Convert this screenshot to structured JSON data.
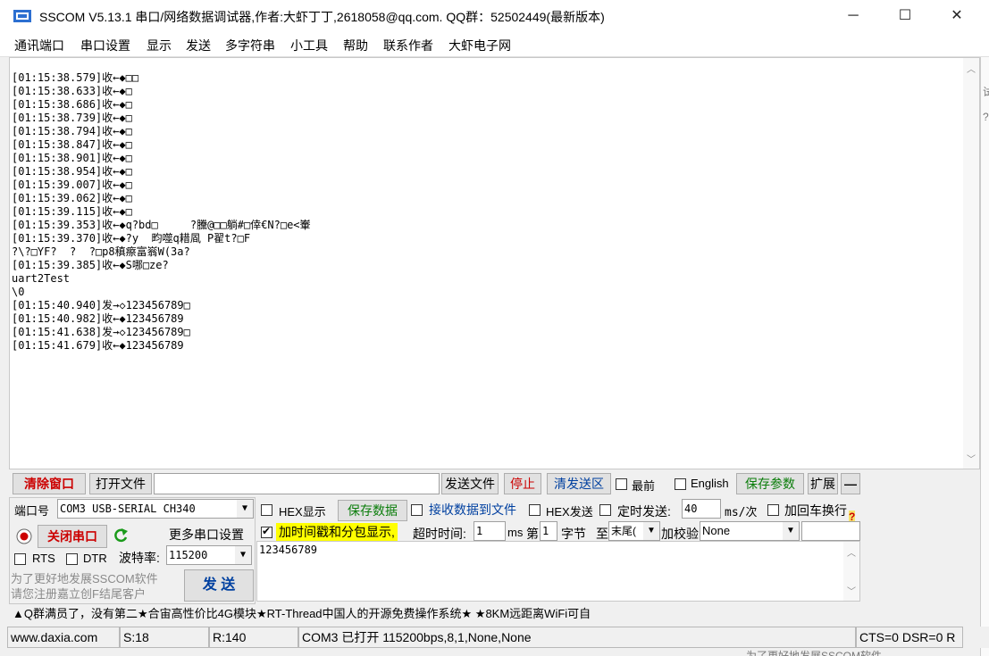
{
  "window": {
    "title": "SSCOM V5.13.1 串口/网络数据调试器,作者:大虾丁丁,2618058@qq.com. QQ群：52502449(最新版本)",
    "minimize": "─",
    "maximize": "☐",
    "close": "✕"
  },
  "menu": [
    "通讯端口",
    "串口设置",
    "显示",
    "发送",
    "多字符串",
    "小工具",
    "帮助",
    "联系作者",
    "大虾电子网"
  ],
  "receive": {
    "lines": [
      "[01:15:38.579]收←◆□□",
      "[01:15:38.633]收←◆□",
      "[01:15:38.686]收←◆□",
      "[01:15:38.739]收←◆□",
      "[01:15:38.794]收←◆□",
      "[01:15:38.847]收←◆□",
      "[01:15:38.901]收←◆□",
      "[01:15:38.954]收←◆□",
      "[01:15:39.007]收←◆□",
      "[01:15:39.062]收←◆□",
      "[01:15:39.115]收←◆□",
      "[01:15:39.353]收←◆q?bd□     ?黱@□□躺#□倖€N?□e<輋",
      "[01:15:39.370]收←◆?y  畇噬q耤凮 P翟t?□F",
      "?\\?□YF?  ?  ?□p8稹瘵富嵡W(3a?",
      "[01:15:39.385]收←◆S哪□ze?",
      "uart2Test",
      "\\0",
      "[01:15:40.940]发→◇123456789□",
      "[01:15:40.982]收←◆123456789",
      "[01:15:41.638]发→◇123456789□",
      "[01:15:41.679]收←◆123456789"
    ]
  },
  "toolbar": {
    "clear_window": "清除窗口",
    "open_file": "打开文件",
    "file_path": "",
    "send_file": "发送文件",
    "stop": "停止",
    "clear_send": "清发送区",
    "topmost": "最前",
    "english": "English",
    "save_params": "保存参数",
    "expand": "扩展",
    "collapse": "—"
  },
  "port": {
    "port_label": "端口号",
    "port_value": "COM3 USB-SERIAL CH340",
    "close_port": "关闭串口",
    "more_settings": "更多串口设置",
    "rts": "RTS",
    "dtr": "DTR",
    "baud_label": "波特率:",
    "baud_value": "115200",
    "promo_hint": "为了更好地发展SSCOM软件\n请您注册嘉立创F结尾客户",
    "send_btn": "发  送"
  },
  "options": {
    "hex_display": "HEX显示",
    "save_data": "保存数据",
    "recv_to_file": "接收数据到文件",
    "hex_send": "HEX发送",
    "timed_send": "定时发送:",
    "timed_value": "40",
    "timed_unit": "ms/次",
    "append_crlf": "加回车换行",
    "help": "?",
    "timestamp": "加时间戳和分包显示,",
    "timeout_label": "超时时间:",
    "timeout_value": "1",
    "timeout_unit": "ms",
    "byte_prefix": "第",
    "byte_value": "1",
    "byte_label": "字节",
    "to_label": "至",
    "to_value": "末尾(",
    "checksum_label": "加校验",
    "checksum_value": "None"
  },
  "send_text": "123456789",
  "promo": "▲Q群满员了，没有第二★合宙高性价比4G模块★RT-Thread中国人的开源免费操作系统★ ★8KM远距离WiFi可自",
  "status": {
    "site": "www.daxia.com",
    "sent": "S:18",
    "received": "R:140",
    "port_state": "COM3 已打开  115200bps,8,1,None,None",
    "lines": "CTS=0 DSR=0 R"
  },
  "background_peek": "为了更好地发展SSCOM软件"
}
